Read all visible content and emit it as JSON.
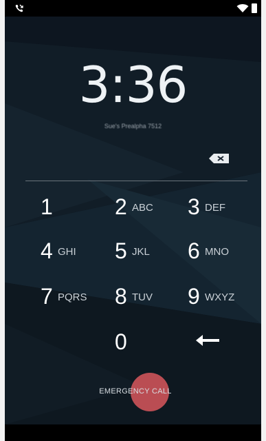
{
  "lockscreen": {
    "time": "3:36",
    "owner_info": "Sue's Prealpha 7512",
    "emergency_label": "EMERGENCY CALL"
  },
  "keypad": {
    "keys": [
      {
        "digit": "1",
        "letters": ""
      },
      {
        "digit": "2",
        "letters": "ABC"
      },
      {
        "digit": "3",
        "letters": "DEF"
      },
      {
        "digit": "4",
        "letters": "GHI"
      },
      {
        "digit": "5",
        "letters": "JKL"
      },
      {
        "digit": "6",
        "letters": "MNO"
      },
      {
        "digit": "7",
        "letters": "PQRS"
      },
      {
        "digit": "8",
        "letters": "TUV"
      },
      {
        "digit": "9",
        "letters": "WXYZ"
      },
      {
        "digit": "0",
        "letters": ""
      }
    ]
  },
  "icons": {
    "status_left": "missed-call-icon",
    "wifi": "wifi-icon",
    "battery": "battery-icon",
    "backspace": "backspace-icon",
    "enter": "enter-arrow-icon"
  },
  "colors": {
    "background": "#0b1118",
    "ripple": "#c95358",
    "text": "#ffffff"
  }
}
